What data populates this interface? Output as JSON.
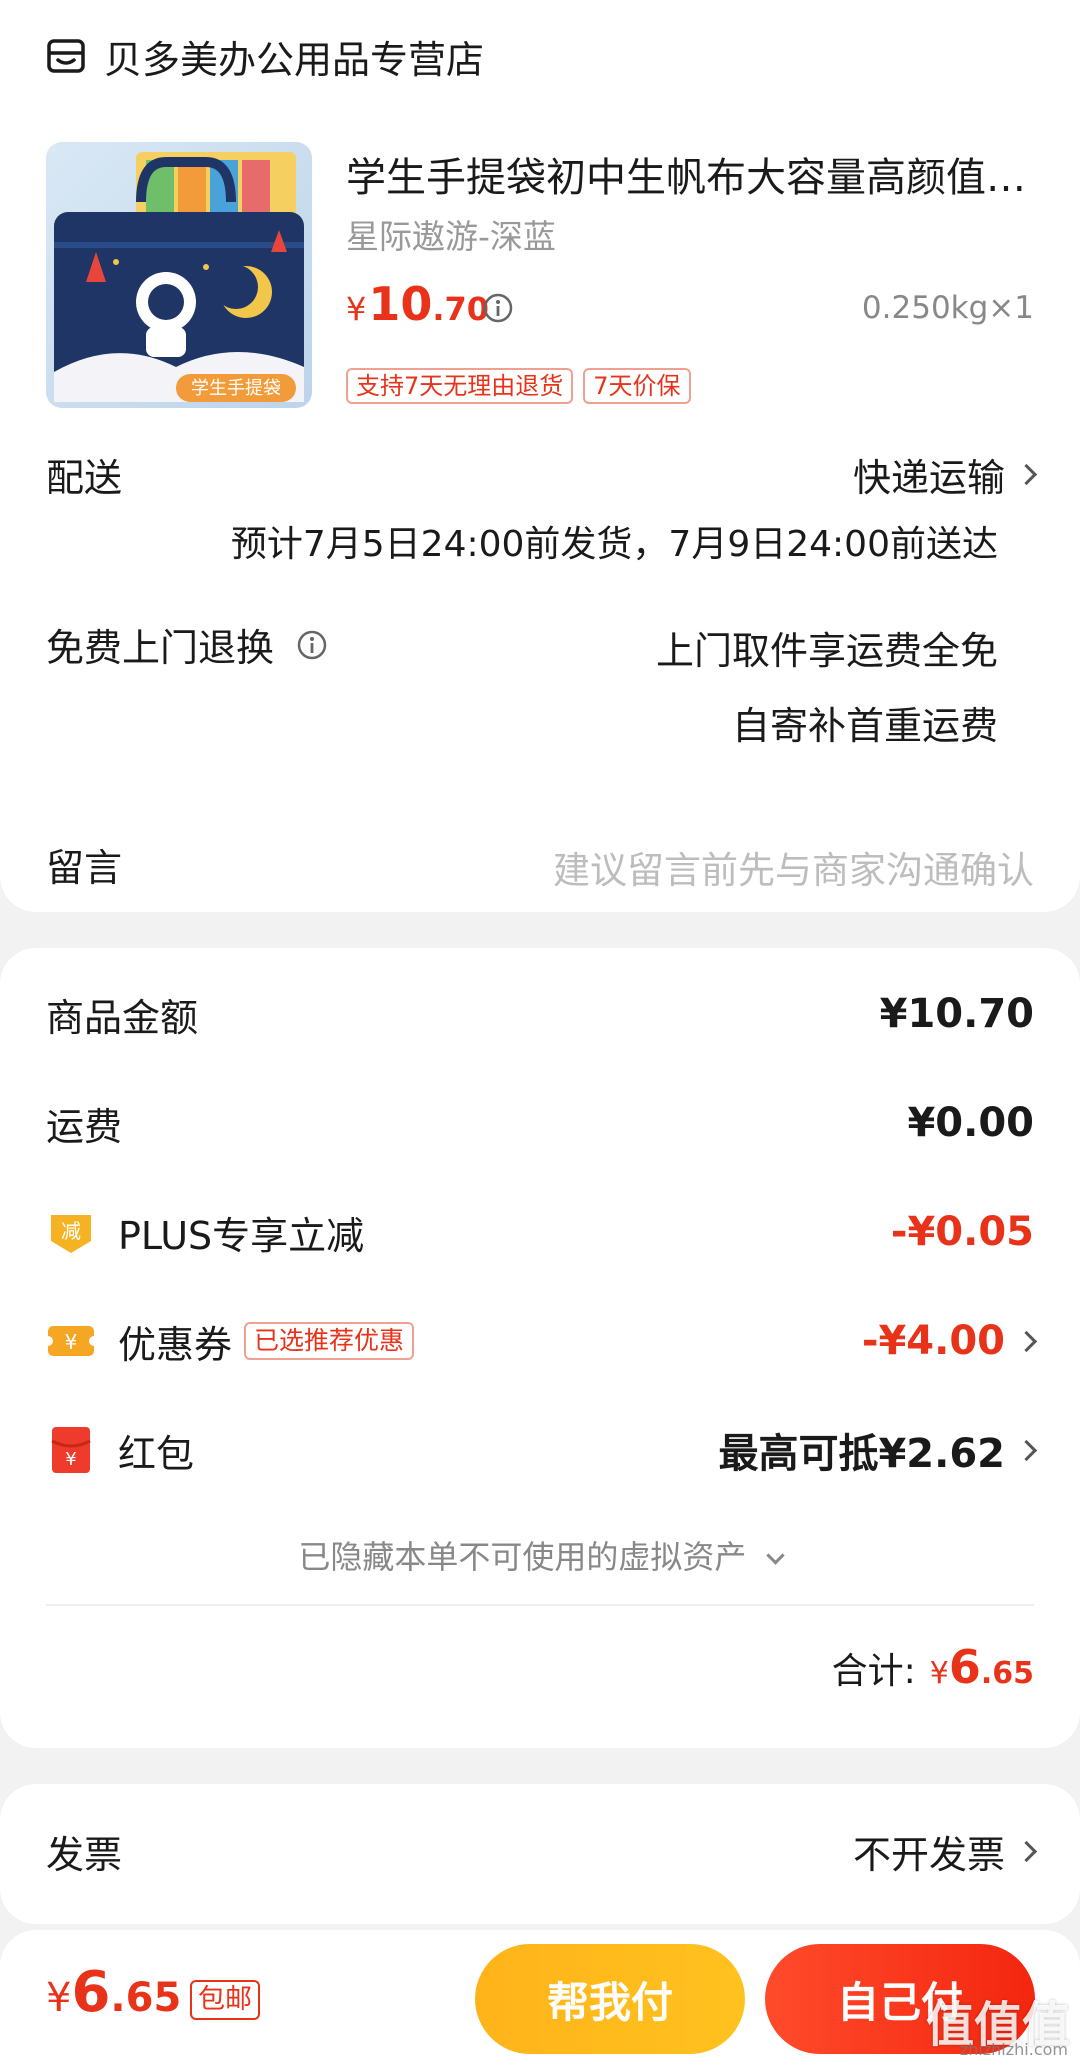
{
  "shop": {
    "name": "贝多美办公用品专营店",
    "icon": "shop-icon"
  },
  "product": {
    "title": "学生手提袋初中生帆布大容量高颜值…",
    "variant": "星际遨游-深蓝",
    "price_currency": "¥",
    "price_int": "10",
    "price_dec": ".70",
    "qty": "0.250kg×1",
    "tags": [
      "支持7天无理由退货",
      "7天价保"
    ],
    "image_caption": "学生手提袋"
  },
  "delivery": {
    "label": "配送",
    "method": "快递运输",
    "time": "预计7月5日24:00前发货，7月9日24:00前送达"
  },
  "returns": {
    "label": "免费上门退换",
    "line1": "上门取件享运费全免",
    "line2": "自寄补首重运费"
  },
  "message": {
    "label": "留言",
    "placeholder": "建议留言前先与商家沟通确认"
  },
  "summary": {
    "goods_label": "商品金额",
    "goods_value": "¥10.70",
    "shipping_label": "运费",
    "shipping_value": "¥0.00",
    "plus_label": "PLUS专享立减",
    "plus_value": "-¥0.05",
    "coupon_label": "优惠券",
    "coupon_tag": "已选推荐优惠",
    "coupon_value": "-¥4.00",
    "redpacket_label": "红包",
    "redpacket_value": "最高可抵¥2.62",
    "hidden_assets": "已隐藏本单不可使用的虚拟资产",
    "total_label": "合计:",
    "total_currency": "¥",
    "total_int": "6",
    "total_dec": ".65",
    "plus_icon_text": "减",
    "coupon_icon_text": "¥",
    "redpacket_icon_text": "¥"
  },
  "invoice": {
    "label": "发票",
    "value": "不开发票"
  },
  "bottom": {
    "price_currency": "¥",
    "price_int": "6",
    "price_dec": ".65",
    "free_shipping": "包邮",
    "help_pay": "帮我付",
    "self_pay": "自己付"
  },
  "watermark": {
    "main": "值值值",
    "sub": "zhizhizhi.com"
  },
  "colors": {
    "accent": "#e8331a",
    "yellow": "#ffb31a",
    "text": "#1a1a1a",
    "muted": "#999999"
  }
}
